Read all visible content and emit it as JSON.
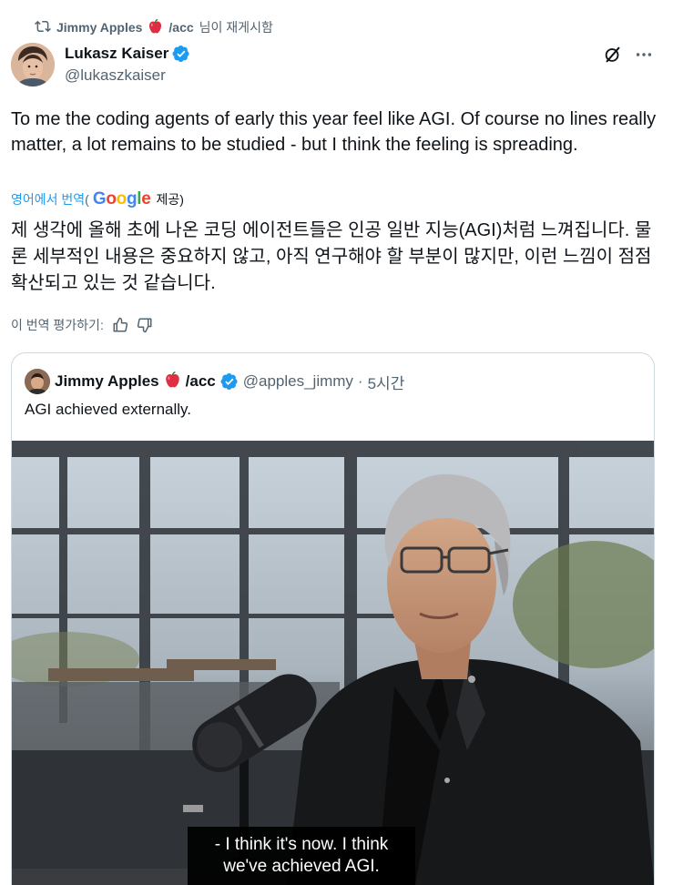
{
  "repost": {
    "user": "Jimmy Apples",
    "suffix_pre": "/acc",
    "suffix": "님이 재게시함",
    "icon": "repost-icon"
  },
  "author": {
    "name": "Lukasz Kaiser",
    "handle": "@lukaszkaiser",
    "verified_icon": "verified-badge-icon"
  },
  "actions": {
    "grok_icon": "grok-icon",
    "more_icon": "more-icon"
  },
  "tweet": {
    "text": "To me the coding agents of early this year feel like AGI. Of course no lines really matter, a lot remains to be studied - but I think the feeling is spreading."
  },
  "translation": {
    "link_label": "영어에서 번역",
    "open_paren": "(",
    "google": "Google",
    "provided": "제공)",
    "text": "제 생각에 올해 초에 나온 코딩 에이전트들은 인공 일반 지능(AGI)처럼 느껴집니다. 물론 세부적인 내용은 중요하지 않고, 아직 연구해야 할 부분이 많지만, 이런 느낌이 점점 확산되고 있는 것 같습니다.",
    "rate_label": "이 번역 평가하기:",
    "thumbs_up_icon": "thumbs-up-icon",
    "thumbs_down_icon": "thumbs-down-icon"
  },
  "quote": {
    "name": "Jimmy Apples",
    "name_suffix": "/acc",
    "handle": "@apples_jimmy",
    "separator": "·",
    "time": "5시간",
    "text": "AGI achieved externally.",
    "subtitle_line1": "- I think it's now. I think",
    "subtitle_line2": "we've achieved AGI."
  },
  "colors": {
    "accent": "#1d9bf0",
    "secondary_text": "#536471",
    "border": "#cfd9de"
  }
}
